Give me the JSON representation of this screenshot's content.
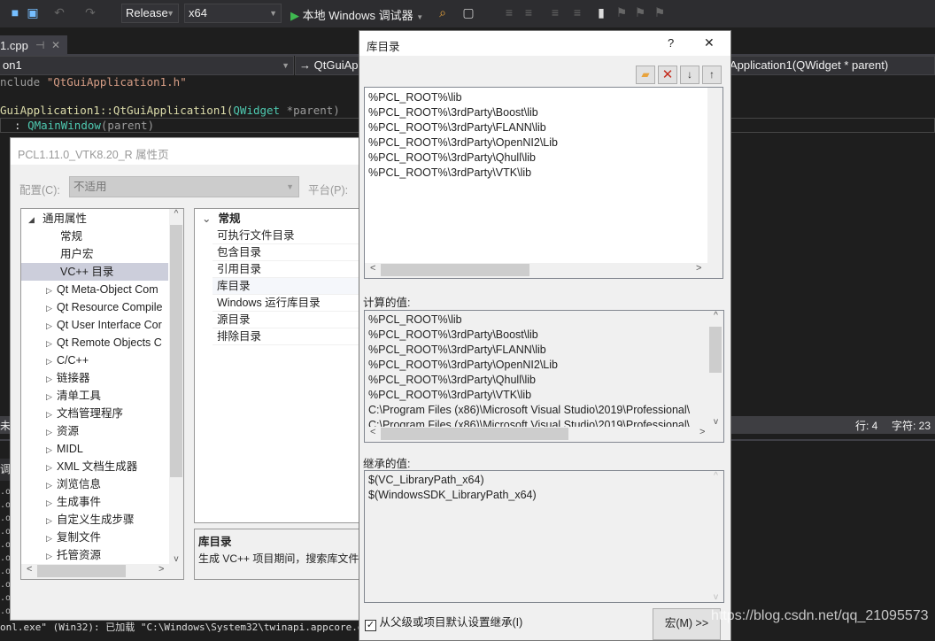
{
  "toolbar": {
    "config": "Release",
    "platform": "x64",
    "run_label": "本地 Windows 调试器"
  },
  "editor": {
    "tab": "1.cpp",
    "nav_left": "on1",
    "nav_mid": "QtGuiApp",
    "nav_right": "Application1(QWidget * parent)",
    "lines": [
      {
        "a": "nclude ",
        "b": "\"QtGuiApplication1.h\""
      },
      {
        "a": "GuiApplication1::QtGuiApplication1(",
        "b": "QWidget",
        " c": " *parent)"
      },
      {
        "a": "  : ",
        "b": "QMainWindow",
        "c": "(parent)"
      }
    ],
    "line1_rest": " *parent)"
  },
  "status": {
    "line": "行: 4",
    "char": "字符: 23",
    "left_fragment": "未找"
  },
  "output": {
    "tab_fragment": "调",
    "prefix": ".or",
    "bottom_line": "onl.exe\" (Win32): 已加载 \"C:\\Windows\\System32\\twinapi.appcore.dll\""
  },
  "prop_page": {
    "title": "PCL1.11.0_VTK8.20_R 属性页",
    "config_label": "配置(C):",
    "config_value": "不适用",
    "platform_label": "平台(P):",
    "tree": [
      {
        "label": "通用属性",
        "exp": "open",
        "ind": 0
      },
      {
        "label": "常规",
        "ind": 2
      },
      {
        "label": "用户宏",
        "ind": 2
      },
      {
        "label": "VC++ 目录",
        "ind": 2,
        "sel": true
      },
      {
        "label": "Qt Meta-Object Com",
        "ind": 1
      },
      {
        "label": "Qt Resource Compile",
        "ind": 1
      },
      {
        "label": "Qt User Interface Cor",
        "ind": 1
      },
      {
        "label": "Qt Remote Objects C",
        "ind": 1
      },
      {
        "label": "C/C++",
        "ind": 1
      },
      {
        "label": "链接器",
        "ind": 1
      },
      {
        "label": "清单工具",
        "ind": 1
      },
      {
        "label": "文档管理程序",
        "ind": 1
      },
      {
        "label": "资源",
        "ind": 1
      },
      {
        "label": "MIDL",
        "ind": 1
      },
      {
        "label": "XML 文档生成器",
        "ind": 1
      },
      {
        "label": "浏览信息",
        "ind": 1
      },
      {
        "label": "生成事件",
        "ind": 1
      },
      {
        "label": "自定义生成步骤",
        "ind": 1
      },
      {
        "label": "复制文件",
        "ind": 1
      },
      {
        "label": "托管资源",
        "ind": 1
      }
    ],
    "grid_header": "常规",
    "grid_rows": [
      "可执行文件目录",
      "包含目录",
      "引用目录",
      "库目录",
      "Windows 运行库目录",
      "源目录",
      "排除目录"
    ],
    "desc_title": "库目录",
    "desc_text": "生成 VC++ 项目期间，搜索库文件"
  },
  "lib_dialog": {
    "title": "库目录",
    "help": "?",
    "close": "✕",
    "entries": [
      "%PCL_ROOT%\\lib",
      "%PCL_ROOT%\\3rdParty\\Boost\\lib",
      "%PCL_ROOT%\\3rdParty\\FLANN\\lib",
      "%PCL_ROOT%\\3rdParty\\OpenNI2\\Lib",
      "%PCL_ROOT%\\3rdParty\\Qhull\\lib",
      "%PCL_ROOT%\\3rdParty\\VTK\\lib"
    ],
    "computed_label": "计算的值:",
    "computed": [
      "%PCL_ROOT%\\lib",
      "%PCL_ROOT%\\3rdParty\\Boost\\lib",
      "%PCL_ROOT%\\3rdParty\\FLANN\\lib",
      "%PCL_ROOT%\\3rdParty\\OpenNI2\\Lib",
      "%PCL_ROOT%\\3rdParty\\Qhull\\lib",
      "%PCL_ROOT%\\3rdParty\\VTK\\lib",
      "C:\\Program Files (x86)\\Microsoft Visual Studio\\2019\\Professional\\",
      "C:\\Program Files (x86)\\Microsoft Visual Studio\\2019\\Professional\\"
    ],
    "inherited_label": "继承的值:",
    "inherited": [
      "$(VC_LibraryPath_x64)",
      "$(WindowsSDK_LibraryPath_x64)"
    ],
    "inherit_checkbox": "从父级或项目默认设置继承(I)",
    "inherit_checked": true,
    "macro_button": "宏(M) >>"
  },
  "watermark": "https://blog.csdn.net/qq_21095573"
}
